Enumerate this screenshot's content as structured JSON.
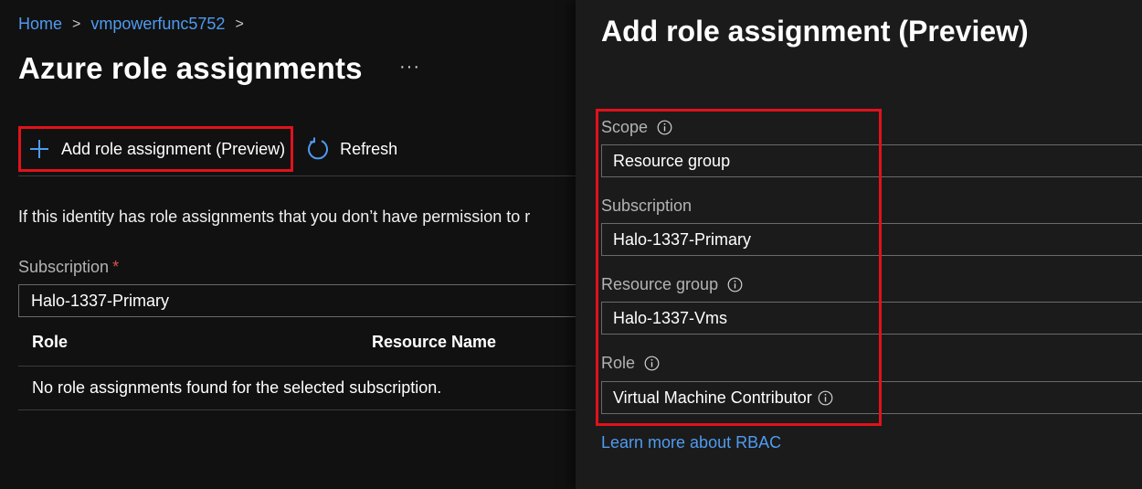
{
  "breadcrumb": {
    "home": "Home",
    "resource": "vmpowerfunc5752",
    "sep1": ">",
    "sep2": ">"
  },
  "page": {
    "title": "Azure role assignments",
    "more": "···"
  },
  "toolbar": {
    "add_label": "Add role assignment (Preview)",
    "refresh_label": "Refresh"
  },
  "info_text": "If this identity has role assignments that you don’t have permission to r",
  "filter": {
    "label": "Subscription",
    "required_mark": "*",
    "value": "Halo-1337-Primary"
  },
  "table": {
    "columns": [
      "Role",
      "Resource Name"
    ],
    "empty_message": "No role assignments found for the selected subscription."
  },
  "panel": {
    "title": "Add role assignment (Preview)",
    "scope": {
      "label": "Scope",
      "value": "Resource group"
    },
    "subscription": {
      "label": "Subscription",
      "value": "Halo-1337-Primary"
    },
    "resource_group": {
      "label": "Resource group",
      "value": "Halo-1337-Vms"
    },
    "role": {
      "label": "Role",
      "value": "Virtual Machine Contributor"
    },
    "learn_more": "Learn more about RBAC"
  },
  "colors": {
    "accent": "#4f9bf0",
    "highlight": "#e0121c",
    "background": "#111111",
    "panel_background": "#1b1b1b"
  },
  "icons": [
    "chevron-right-icon",
    "plus-icon",
    "refresh-icon",
    "info-icon",
    "more-icon"
  ]
}
